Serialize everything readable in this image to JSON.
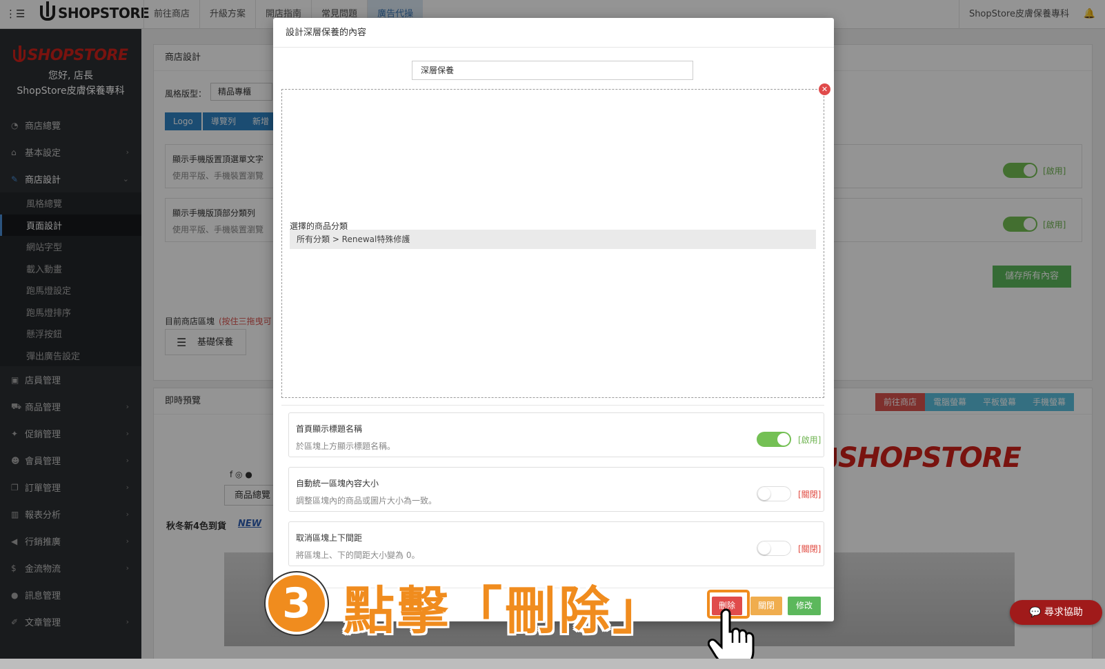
{
  "topbar": {
    "menu_icon": "hamburger-icon",
    "logo_text": "SHOPSTORE",
    "nav": [
      "前往商店",
      "升級方案",
      "開店指南",
      "常見問題",
      "廣告代操"
    ],
    "active_nav": "廣告代操",
    "store_name": "ShopStore皮膚保養專科"
  },
  "sidebar": {
    "logo_text": "SHOPSTORE",
    "greeting": "您好, 店長",
    "store_name": "ShopStore皮膚保養專科",
    "items": [
      {
        "label": "商店總覽",
        "icon": "dashboard-icon"
      },
      {
        "label": "基本設定",
        "icon": "bank-icon"
      },
      {
        "label": "商店設計",
        "icon": "magic-wand-icon"
      },
      {
        "label": "店員管理",
        "icon": "lock-icon"
      },
      {
        "label": "商品管理",
        "icon": "cart-icon"
      },
      {
        "label": "促銷管理",
        "icon": "gift-icon"
      },
      {
        "label": "會員管理",
        "icon": "users-icon"
      },
      {
        "label": "訂單管理",
        "icon": "copy-icon"
      },
      {
        "label": "報表分析",
        "icon": "bar-chart-icon"
      },
      {
        "label": "行銷推廣",
        "icon": "bullhorn-icon"
      },
      {
        "label": "金流物流",
        "icon": "dollar-icon"
      },
      {
        "label": "訊息管理",
        "icon": "comments-icon"
      },
      {
        "label": "文章管理",
        "icon": "edit-icon"
      }
    ],
    "sub_items": [
      "風格總覽",
      "頁面設計",
      "網站字型",
      "載入動畫",
      "跑馬燈設定",
      "跑馬燈排序",
      "懸浮按鈕",
      "彈出廣告設定"
    ],
    "active_sub": "頁面設計"
  },
  "background": {
    "panel_title": "商店設計",
    "style_label": "風格版型：",
    "style_value": "精品專櫃",
    "tabs": [
      "Logo",
      "導覽列",
      "新增"
    ],
    "row1_title": "顯示手機版置頂選單文字",
    "row1_desc": "使用平版、手機裝置瀏覽",
    "row2_title": "顯示手機版頂部分類列",
    "row2_desc": "使用平版、手機裝置瀏覽",
    "enabled_label": "[啟用]",
    "save_all": "儲存所有內容",
    "blocks_label": "目前商店區塊",
    "blocks_hint": "(按住三拖曳可",
    "block_name": "基礎保養",
    "preview_title": "即時預覽",
    "preview_buttons": [
      "前往商店",
      "電腦螢幕",
      "平板螢幕",
      "手機螢幕"
    ],
    "preview_nav": "商品總覽",
    "preview_banner": "秋冬新4色到貨",
    "preview_new_tag": "NEW",
    "preview_logo": "SHOPSTORE"
  },
  "modal": {
    "header": "設計深層保養的內容",
    "title_value": "深層保養",
    "category_label": "選擇的商品分類",
    "category_value": "所有分類 > Renewal特殊修護",
    "options": [
      {
        "title": "首頁顯示標題名稱",
        "desc": "於區塊上方顯示標題名稱。",
        "state": "on",
        "state_label": "[啟用]"
      },
      {
        "title": "自動統一區塊內容大小",
        "desc": "調整區塊內的商品或圖片大小為一致。",
        "state": "off",
        "state_label": "[關閉]"
      },
      {
        "title": "取消區塊上下間距",
        "desc": "將區塊上、下的間距大小變為 0。",
        "state": "off",
        "state_label": "[關閉]"
      }
    ],
    "delete_label": "刪除",
    "close_label": "關閉",
    "edit_label": "修改"
  },
  "annotation": {
    "step_number": "3",
    "text": "點擊「刪除」"
  },
  "help_button": "尋求協助",
  "colors": {
    "brand_red": "#d0211b",
    "accent_orange": "#f08c1e",
    "primary_blue": "#2f83c5",
    "success_green": "#5cb85c",
    "toggle_on": "#74c054",
    "danger_red": "#e04b4b",
    "warning_orange": "#f0ad4e"
  }
}
